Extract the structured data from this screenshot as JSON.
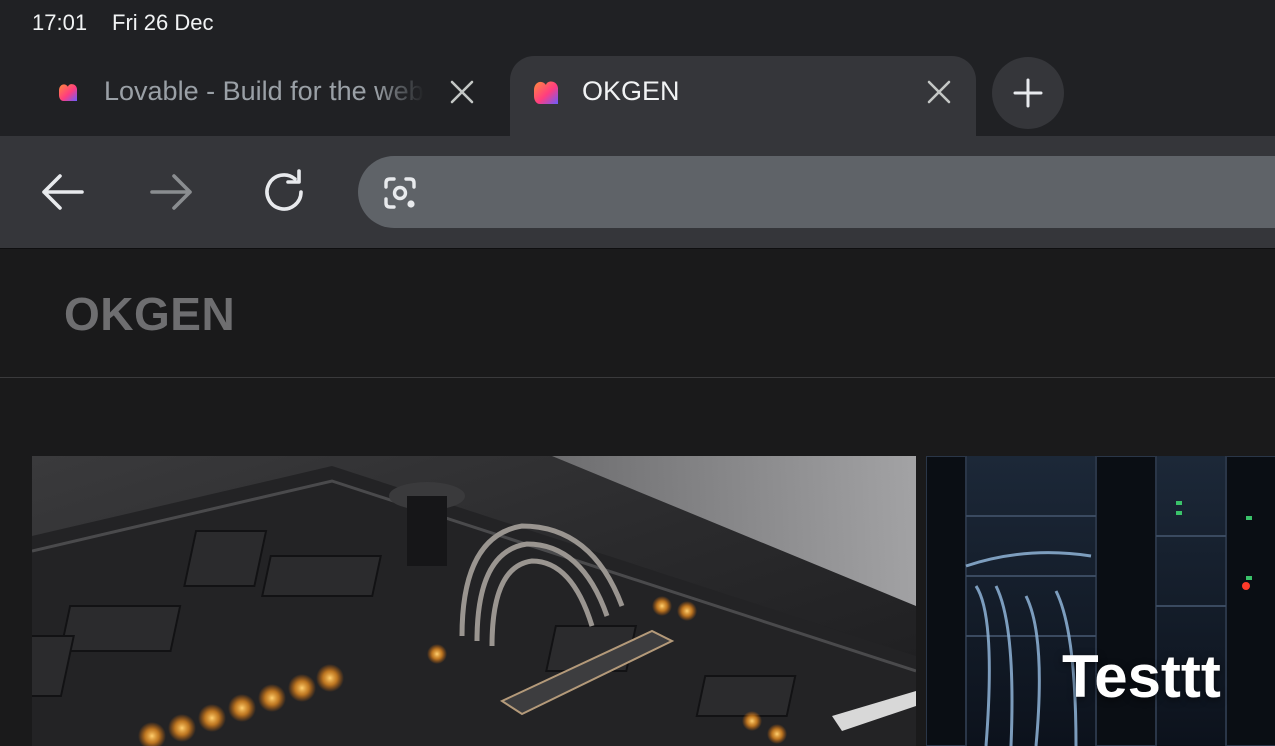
{
  "status_bar": {
    "time": "17:01",
    "date": "Fri 26 Dec"
  },
  "tabs": [
    {
      "title": "Lovable - Build for the web",
      "active": false
    },
    {
      "title": "OKGEN",
      "active": true
    }
  ],
  "toolbar": {
    "url": "",
    "url_placeholder": ""
  },
  "site": {
    "brand": "OKGEN",
    "cards": [
      {
        "title": "",
        "image": "glowing circuit board"
      },
      {
        "title": "Testtt",
        "image": "server rack with cables"
      }
    ]
  },
  "colors": {
    "chrome_bg": "#202124",
    "active_tab": "#35363a",
    "omnibox": "#5f6368",
    "page_bg": "#1a1a1b",
    "brand_text": "#6e6e70",
    "glow": "#ffb020"
  }
}
